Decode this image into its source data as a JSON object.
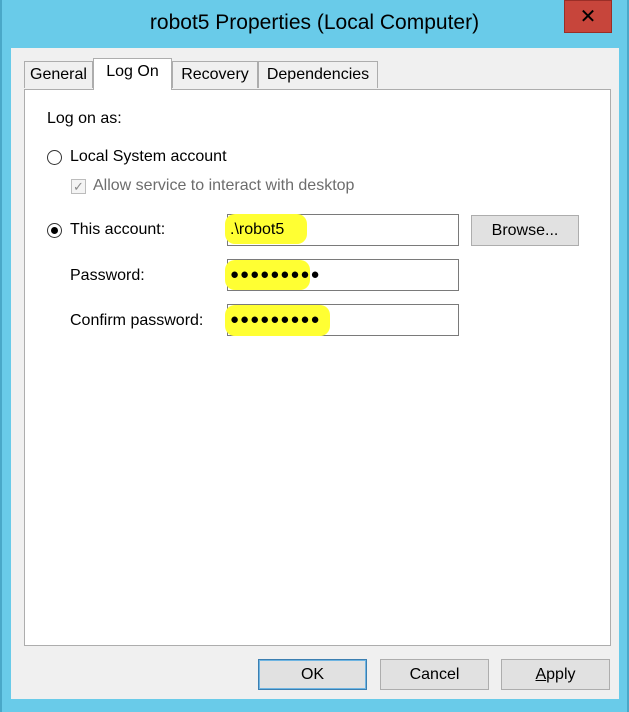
{
  "window": {
    "title": "robot5 Properties (Local Computer)",
    "close_glyph": "✕"
  },
  "tabs": [
    {
      "label": "General",
      "active": false
    },
    {
      "label": "Log On",
      "active": true
    },
    {
      "label": "Recovery",
      "active": false
    },
    {
      "label": "Dependencies",
      "active": false
    }
  ],
  "logon": {
    "heading": "Log on as:",
    "local_system": {
      "label": "Local System account",
      "selected": false
    },
    "interact_desktop": {
      "label": "Allow service to interact with desktop",
      "checked": true,
      "enabled": false
    },
    "this_account": {
      "label": "This account:",
      "selected": true,
      "value": ".\\robot5"
    },
    "browse_label": "Browse...",
    "password": {
      "label": "Password:",
      "value": "●●●●●●●●●"
    },
    "confirm_password": {
      "label": "Confirm password:",
      "value": "●●●●●●●●●"
    }
  },
  "footer": {
    "ok_label": "OK",
    "cancel_label": "Cancel",
    "apply_label": "Apply"
  },
  "colors": {
    "titlebar": "#69cbe9",
    "close_button": "#c7453b",
    "highlight": "#ffff33"
  }
}
